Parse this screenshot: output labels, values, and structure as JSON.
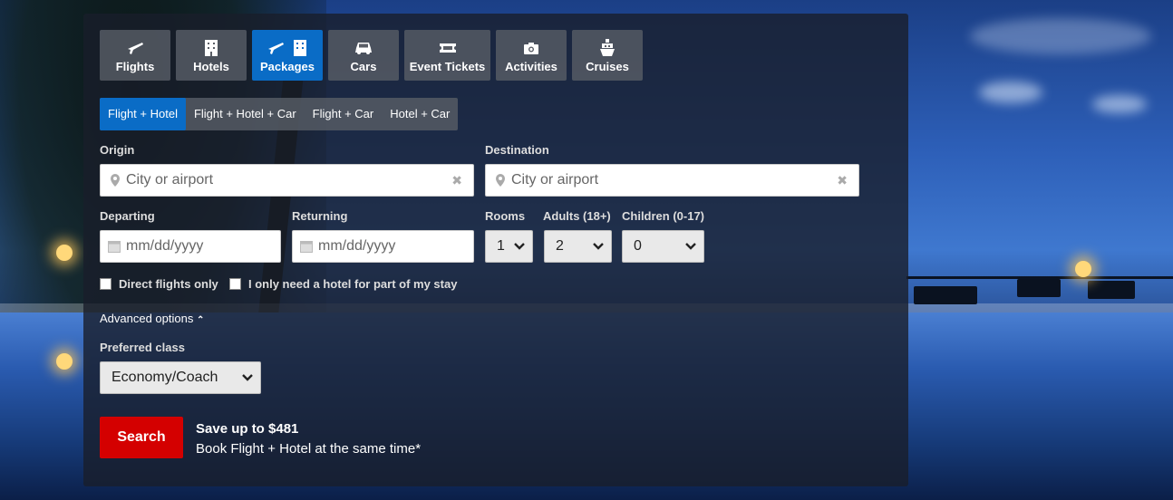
{
  "tabs": [
    {
      "label": "Flights",
      "icon": "plane-icon"
    },
    {
      "label": "Hotels",
      "icon": "building-icon"
    },
    {
      "label": "Packages",
      "icon": "plane-building-icon"
    },
    {
      "label": "Cars",
      "icon": "car-icon"
    },
    {
      "label": "Event Tickets",
      "icon": "ticket-icon"
    },
    {
      "label": "Activities",
      "icon": "camera-icon"
    },
    {
      "label": "Cruises",
      "icon": "ship-icon"
    }
  ],
  "active_tab": "Packages",
  "subtabs": [
    "Flight + Hotel",
    "Flight + Hotel + Car",
    "Flight + Car",
    "Hotel + Car"
  ],
  "active_subtab": "Flight + Hotel",
  "origin": {
    "label": "Origin",
    "placeholder": "City or airport"
  },
  "destination": {
    "label": "Destination",
    "placeholder": "City or airport"
  },
  "departing": {
    "label": "Departing",
    "placeholder": "mm/dd/yyyy"
  },
  "returning": {
    "label": "Returning",
    "placeholder": "mm/dd/yyyy"
  },
  "rooms": {
    "label": "Rooms",
    "value": "1"
  },
  "adults": {
    "label": "Adults (18+)",
    "value": "2"
  },
  "children": {
    "label": "Children (0-17)",
    "value": "0"
  },
  "checkboxes": {
    "direct": "Direct flights only",
    "partial_hotel": "I only need a hotel for part of my stay"
  },
  "advanced_options": "Advanced options",
  "preferred_class": {
    "label": "Preferred class",
    "value": "Economy/Coach"
  },
  "search_label": "Search",
  "promo": {
    "headline": "Save up to $481",
    "sub": "Book Flight + Hotel at the same time*"
  },
  "colors": {
    "active": "#0a6cc6",
    "search": "#d40000"
  }
}
